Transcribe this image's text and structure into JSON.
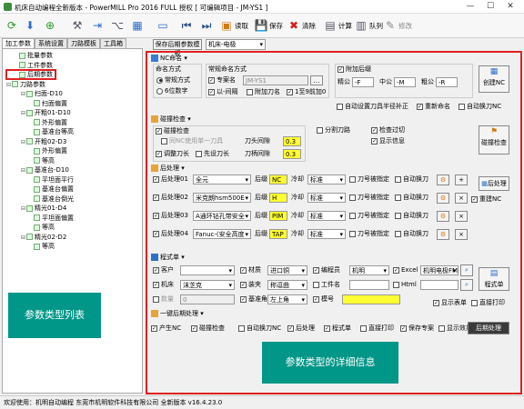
{
  "window": {
    "title": "机床自动编程全新版本 - PowerMILL Pro 2016 FULL 授权   [ 可编辑项目 - JM-YS1 ]"
  },
  "toolbar": {
    "read": "读取",
    "save": "保存",
    "clear": "清除",
    "calc": "计算",
    "queue": "队列",
    "modify": "修改"
  },
  "left": {
    "tabs": [
      "加工参数",
      "系统设置",
      "刀路模板",
      "工具箱"
    ],
    "tree": [
      {
        "label": "批量参数",
        "indent": 1,
        "exp": ""
      },
      {
        "label": "工件参数",
        "indent": 1,
        "exp": ""
      },
      {
        "label": "后期参数",
        "indent": 1,
        "exp": ""
      },
      {
        "label": "刀路参数",
        "indent": 0,
        "exp": "⊟"
      },
      {
        "label": "扫面-D10",
        "indent": 2,
        "exp": "⊟"
      },
      {
        "label": "扫面偏置",
        "indent": 3,
        "exp": ""
      },
      {
        "label": "开粗01-D10",
        "indent": 2,
        "exp": "⊟"
      },
      {
        "label": "外形偏置",
        "indent": 3,
        "exp": ""
      },
      {
        "label": "基准台等高",
        "indent": 3,
        "exp": ""
      },
      {
        "label": "开粗02-D3",
        "indent": 2,
        "exp": "⊟"
      },
      {
        "label": "外形偏置",
        "indent": 3,
        "exp": ""
      },
      {
        "label": "等高",
        "indent": 3,
        "exp": ""
      },
      {
        "label": "基准台-D10",
        "indent": 2,
        "exp": "⊟"
      },
      {
        "label": "平坦面平行",
        "indent": 3,
        "exp": ""
      },
      {
        "label": "基准台偏置",
        "indent": 3,
        "exp": ""
      },
      {
        "label": "基准台倒光",
        "indent": 3,
        "exp": ""
      },
      {
        "label": "精光01-D4",
        "indent": 2,
        "exp": "⊟"
      },
      {
        "label": "平坦面偏置",
        "indent": 3,
        "exp": ""
      },
      {
        "label": "等高",
        "indent": 3,
        "exp": ""
      },
      {
        "label": "精光02-D2",
        "indent": 2,
        "exp": "⊟"
      },
      {
        "label": "等高",
        "indent": 3,
        "exp": ""
      }
    ],
    "overlay_label": "参数类型列表"
  },
  "right": {
    "top_button": "保存后期参数模板",
    "machine_select": "机床-电极",
    "nc": {
      "header": "NC命名",
      "naming_label": "命名方式",
      "naming_options": [
        "常规方式",
        "6位数字"
      ],
      "regular_label": "常规命名方式",
      "use_part_name": "专案名",
      "part_name": "JM-YS1",
      "opt_prefix": "以-间隔",
      "opt_tool": "附加刀名",
      "opt_start": "1至9前加0",
      "suffix_label": "附加后缀",
      "coarse_label": "精公",
      "coarse_val": "-F",
      "mid_label": "中公",
      "mid_val": "-M",
      "fine_label": "粗公",
      "fine_val": "-R",
      "create_button": "创建NC",
      "opt_auto_radius": "自动设置刀具半径补正",
      "opt_rename": "重新命名",
      "opt_autochange": "自动换刀NC"
    },
    "collision": {
      "header": "碰撞检查",
      "opt_check": "碰撞检查",
      "opt_nc_one": "同NC使用单一刀具",
      "opt_adjust": "调整刀长",
      "opt_first": "先设刀长",
      "tool_gap_label": "刀头间隙",
      "tool_gap": "0.3",
      "holder_gap_label": "刀柄间隙",
      "holder_gap": "0.3",
      "opt_split": "分割刀路",
      "opt_overcut": "检查过切",
      "opt_show": "显示信息",
      "check_button": "碰撞检查"
    },
    "post": {
      "header": "后处理",
      "rows": [
        {
          "label": "后处理01",
          "name": "全元",
          "suffix": "NC",
          "cool": "标准"
        },
        {
          "label": "后处理02",
          "name": "米克朗hsm500E",
          "suffix": "H",
          "cool": "标准"
        },
        {
          "label": "后处理03",
          "name": "A通环钻孔带安全",
          "suffix": "PIM",
          "cool": "标准"
        },
        {
          "label": "后处理04",
          "name": "Fanuc-(安全高度",
          "suffix": "TAP",
          "cool": "标准"
        }
      ],
      "suffix_label": "后缀",
      "cool_label": "冷却",
      "opt_knife_num": "刀号被指定",
      "opt_autochange": "自动换刀",
      "post_button": "后处理",
      "opt_rename": "重建NC"
    },
    "program": {
      "header": "程式单",
      "customer_label": "客户",
      "customer": "",
      "material_label": "材质",
      "material": "进口铜",
      "programmer_label": "编程员",
      "programmer": "机明",
      "excel_label": "Excel",
      "excel": "机明电极FMR",
      "program_button": "程式单",
      "machine_label": "机床",
      "machine": "沫芝克",
      "fixture_label": "装夹",
      "fixture": "称逗曲",
      "workpiece_label": "工件名",
      "workpiece": "",
      "html_label": "Html",
      "qty_label": "数量",
      "qty": "0",
      "datum_label": "基准角",
      "datum": "左上角",
      "model_label": "模号",
      "model": "",
      "opt_show_table": "显示表单",
      "opt_print": "直接打印"
    },
    "oneclick": {
      "header": "一键后期处理",
      "opts": [
        "产生NC",
        "碰撞检查",
        "自动换刀NC",
        "后处理",
        "程式单",
        "直接打印",
        "保存专案",
        "显示效果"
      ],
      "run_button": "后期处理"
    },
    "overlay_label": "参数类型的详细信息"
  },
  "status": {
    "text": "欢迎使用：机明自动编程 东莞市机明软件科技有限公司 全新版本 v16.4.23.0"
  },
  "colors": {
    "red_border": "#e02020",
    "teal": "#009688",
    "yellow": "#ffff33"
  }
}
